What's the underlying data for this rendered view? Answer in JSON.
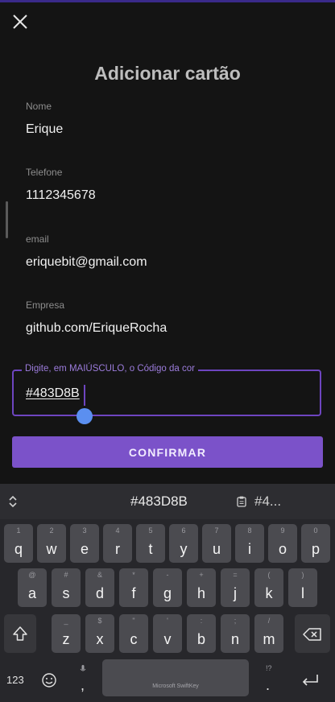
{
  "header": {
    "title": "Adicionar cartão",
    "close_icon": "close-icon"
  },
  "fields": [
    {
      "label": "Nome",
      "value": "Erique"
    },
    {
      "label": "Telefone",
      "value": "1112345678"
    },
    {
      "label": "email",
      "value": "eriquebit@gmail.com"
    },
    {
      "label": "Empresa",
      "value": "github.com/EriqueRocha"
    }
  ],
  "color_input": {
    "label": "Digite, em MAIÚSCULO, o Código da cor",
    "value": "#483D8B"
  },
  "confirm_label": "CONFIRMAR",
  "colors": {
    "accent": "#7B52C9",
    "outline": "#6E45C0",
    "cursor_handle": "#5B8FF0"
  },
  "keyboard": {
    "suggestions": {
      "center": "#483D8B",
      "clipboard": "#4..."
    },
    "row1": [
      {
        "hint": "1",
        "key": "q"
      },
      {
        "hint": "2",
        "key": "w"
      },
      {
        "hint": "3",
        "key": "e"
      },
      {
        "hint": "4",
        "key": "r"
      },
      {
        "hint": "5",
        "key": "t"
      },
      {
        "hint": "6",
        "key": "y"
      },
      {
        "hint": "7",
        "key": "u"
      },
      {
        "hint": "8",
        "key": "i"
      },
      {
        "hint": "9",
        "key": "o"
      },
      {
        "hint": "0",
        "key": "p"
      }
    ],
    "row2": [
      {
        "hint": "@",
        "key": "a"
      },
      {
        "hint": "#",
        "key": "s"
      },
      {
        "hint": "&",
        "key": "d"
      },
      {
        "hint": "*",
        "key": "f"
      },
      {
        "hint": "-",
        "key": "g"
      },
      {
        "hint": "+",
        "key": "h"
      },
      {
        "hint": "=",
        "key": "j"
      },
      {
        "hint": "(",
        "key": "k"
      },
      {
        "hint": ")",
        "key": "l"
      }
    ],
    "row3": [
      {
        "hint": "_",
        "key": "z"
      },
      {
        "hint": "$",
        "key": "x"
      },
      {
        "hint": "\"",
        "key": "c"
      },
      {
        "hint": "'",
        "key": "v"
      },
      {
        "hint": ":",
        "key": "b"
      },
      {
        "hint": ";",
        "key": "n"
      },
      {
        "hint": "/",
        "key": "m"
      }
    ],
    "numbers_key": "123",
    "comma_key": ",",
    "period_key": ".",
    "space_brand": "Microsoft SwiftKey"
  }
}
